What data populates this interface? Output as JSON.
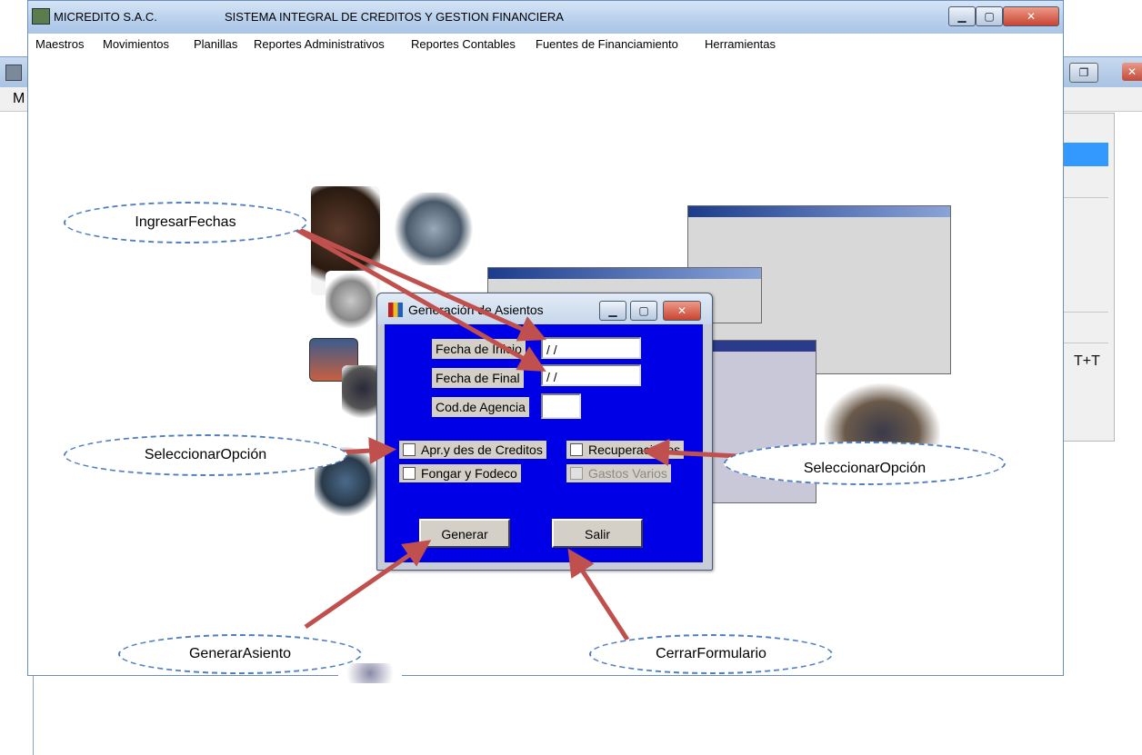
{
  "background_app": {
    "menu_letter": "M",
    "side_panel_text": "T+T"
  },
  "app": {
    "company": "MICREDITO S.A.C.",
    "system_title": "SISTEMA INTEGRAL DE CREDITOS Y GESTION FINANCIERA",
    "menu": [
      {
        "label": "Maestros"
      },
      {
        "label": "Movimientos"
      },
      {
        "label": "Planillas"
      },
      {
        "label": "Reportes Administrativos"
      },
      {
        "label": "Reportes Contables"
      },
      {
        "label": "Fuentes de Financiamiento"
      },
      {
        "label": "Herramientas"
      }
    ]
  },
  "dialog": {
    "title": "Generación de Asientos",
    "fecha_inicio_label": "Fecha de Inicio",
    "fecha_inicio_value": " / /",
    "fecha_final_label": "Fecha de Final",
    "fecha_final_value": " / /",
    "cod_agencia_label": "Cod.de Agencia",
    "cod_agencia_value": "",
    "checkboxes": [
      {
        "label": "Apr.y des de Creditos",
        "enabled": true,
        "checked": false
      },
      {
        "label": "Recuperaciones",
        "enabled": true,
        "checked": false
      },
      {
        "label": "Fongar y Fodeco",
        "enabled": true,
        "checked": false
      },
      {
        "label": "Gastos Varios",
        "enabled": false,
        "checked": false
      }
    ],
    "generar_label": "Generar",
    "salir_label": "Salir"
  },
  "callouts": {
    "ingresar_fechas": "IngresarFechas",
    "seleccionar_opcion_left": "SeleccionarOpción",
    "seleccionar_opcion_right": "SeleccionarOpción",
    "generar_asiento": "GenerarAsiento",
    "cerrar_formulario": "CerrarFormulario"
  },
  "colors": {
    "dialog_body": "#0000e6",
    "arrow": "#c0504d",
    "callout_border": "#4f7fc0"
  }
}
